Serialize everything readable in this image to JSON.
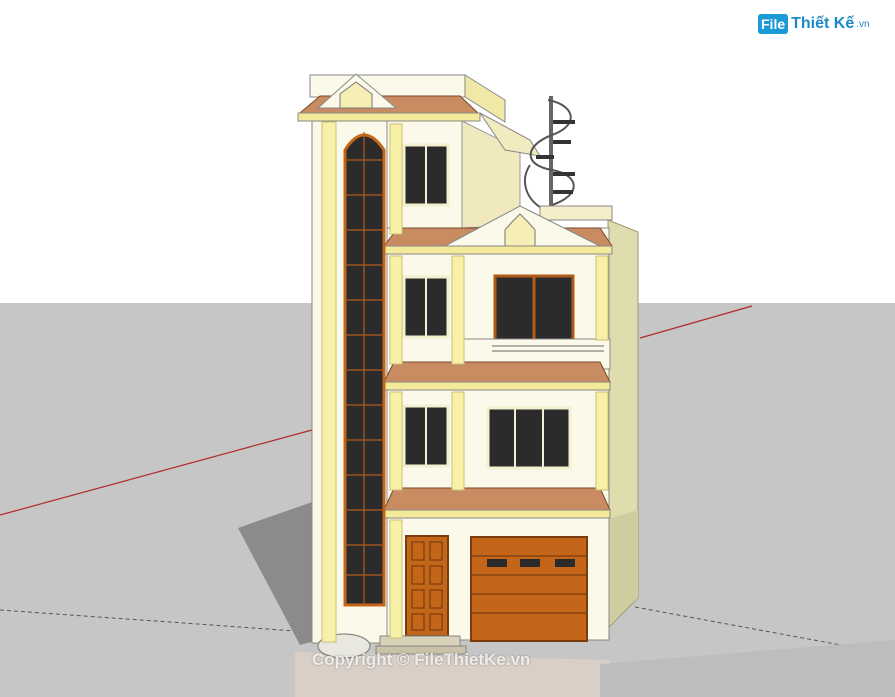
{
  "logo": {
    "badge": "File",
    "text": "Thiết Kế",
    "suffix": ".vn",
    "brand_color": "#1a9bd7"
  },
  "watermark": {
    "text": "Copyright © FileThietKe.vn"
  },
  "colors": {
    "sky": "#ffffff",
    "ground": "#c6c6c6",
    "wall_cream": "#f4f1c8",
    "column_yellow": "#f7f0a6",
    "roof_tile": "#c98c62",
    "wood": "#c4661a",
    "glass": "#2b2b2b"
  }
}
